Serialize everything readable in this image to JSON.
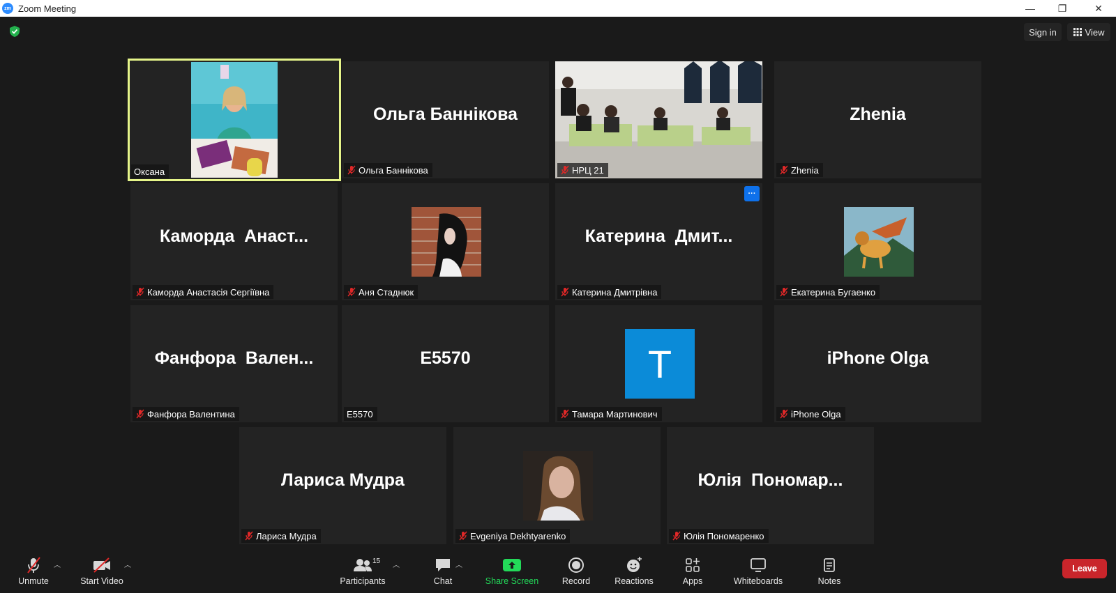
{
  "window": {
    "title": "Zoom Meeting",
    "logo_text": "zm",
    "minimize": "—",
    "restore": "❐",
    "close": "✕"
  },
  "topbar": {
    "sign_in": "Sign in",
    "view": "View"
  },
  "tiles": [
    {
      "big": "",
      "label": "Оксана",
      "muted": false,
      "active": true,
      "kind": "video-portrait"
    },
    {
      "big": "Ольга Баннікова",
      "label": "Ольга Баннікова",
      "muted": true
    },
    {
      "big": "",
      "label": "НРЦ 21",
      "muted": true,
      "kind": "video-classroom"
    },
    {
      "big": "Zhenia",
      "label": "Zhenia",
      "muted": true
    },
    {
      "big": "Каморда  Анаст...",
      "label": "Каморда Анастасія Сергіївна",
      "muted": true
    },
    {
      "big": "",
      "label": "Аня Стаднюк",
      "muted": true,
      "kind": "avatar-brick"
    },
    {
      "big": "Катерина  Дмит...",
      "label": "Катерина Дмитрівна",
      "muted": true,
      "more": "···"
    },
    {
      "big": "",
      "label": "Екатерина Бугаенко",
      "muted": true,
      "kind": "avatar-griffin"
    },
    {
      "big": "Фанфора  Вален...",
      "label": "Фанфора Валентина",
      "muted": true
    },
    {
      "big": "E5570",
      "label": "E5570",
      "muted": false
    },
    {
      "big": "",
      "label": "Тамара Мартинович",
      "muted": true,
      "kind": "avatar-letter",
      "letter": "T",
      "letter_color": "#0b8bd8"
    },
    {
      "big": "iPhone Olga",
      "label": "iPhone Olga",
      "muted": true
    },
    {
      "big": "Лариса Мудра",
      "label": "Лариса Мудра",
      "muted": true
    },
    {
      "big": "",
      "label": "Evgeniya Dekhtyarenko",
      "muted": true,
      "kind": "avatar-woman"
    },
    {
      "big": "Юлія  Пономар...",
      "label": "Юлія Пономаренко",
      "muted": true
    }
  ],
  "toolbar": {
    "unmute": "Unmute",
    "start_video": "Start Video",
    "participants": "Participants",
    "participant_count": "15",
    "chat": "Chat",
    "share_screen": "Share Screen",
    "record": "Record",
    "reactions": "Reactions",
    "apps": "Apps",
    "whiteboards": "Whiteboards",
    "notes": "Notes",
    "leave": "Leave",
    "share_color": "#23d959",
    "leave_color": "#c9252b"
  }
}
